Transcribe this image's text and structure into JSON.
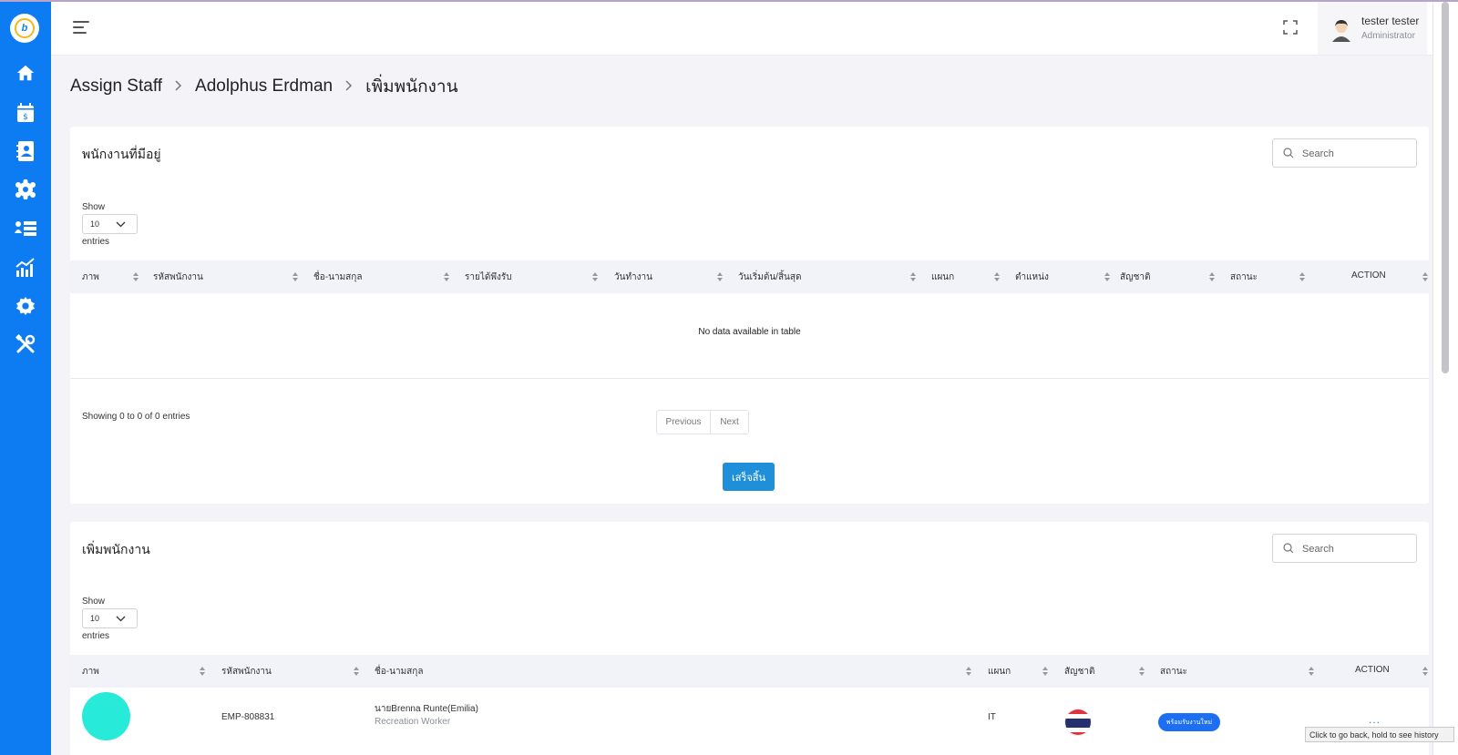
{
  "brand": {
    "logo_text": "b",
    "accent": "#0d7cf2"
  },
  "sidebar": {
    "items": [
      {
        "icon": "home-icon"
      },
      {
        "icon": "calendar-money-icon"
      },
      {
        "icon": "contact-book-icon"
      },
      {
        "icon": "team-gear-icon"
      },
      {
        "icon": "staff-list-icon"
      },
      {
        "icon": "chart-icon"
      },
      {
        "icon": "settings-gear-icon"
      },
      {
        "icon": "tools-icon"
      }
    ]
  },
  "header": {
    "user_name": "tester tester",
    "user_role": "Administrator"
  },
  "breadcrumb": [
    "Assign Staff",
    "Adolphus Erdman",
    "เพิ่มพนักงาน"
  ],
  "existing_staff": {
    "title": "พนักงานที่มีอยู่",
    "search_placeholder": "Search",
    "show_label": "Show",
    "page_length": "10",
    "entries_label": "entries",
    "columns": [
      "ภาพ",
      "รหัสพนักงาน",
      "ชื่อ-นามสกุล",
      "รายได้พึงรับ",
      "วันทำงาน",
      "วันเริ่มต้น/สิ้นสุด",
      "แผนก",
      "ตำแหน่ง",
      "สัญชาติ",
      "สถานะ",
      "ACTION"
    ],
    "empty_text": "No data available in table",
    "info": "Showing 0 to 0 of 0 entries",
    "prev_label": "Previous",
    "next_label": "Next",
    "done_label": "เสร็จสิ้น"
  },
  "add_staff": {
    "title": "เพิ่มพนักงาน",
    "search_placeholder": "Search",
    "show_label": "Show",
    "page_length": "10",
    "entries_label": "entries",
    "columns": [
      "ภาพ",
      "รหัสพนักงาน",
      "ชื่อ-นามสกุล",
      "แผนก",
      "สัญชาติ",
      "สถานะ",
      "ACTION"
    ],
    "rows": [
      {
        "photo_color": "#27ebd8",
        "code": "EMP-808831",
        "name": "นายBrenna Runte(Emilia)",
        "position": "Recreation Worker",
        "department": "IT",
        "nationality_flag": "thailand-flag-icon",
        "status": "พร้อมรับงานใหม่",
        "action": "..."
      }
    ]
  },
  "tooltip": "Click to go back, hold to see history"
}
